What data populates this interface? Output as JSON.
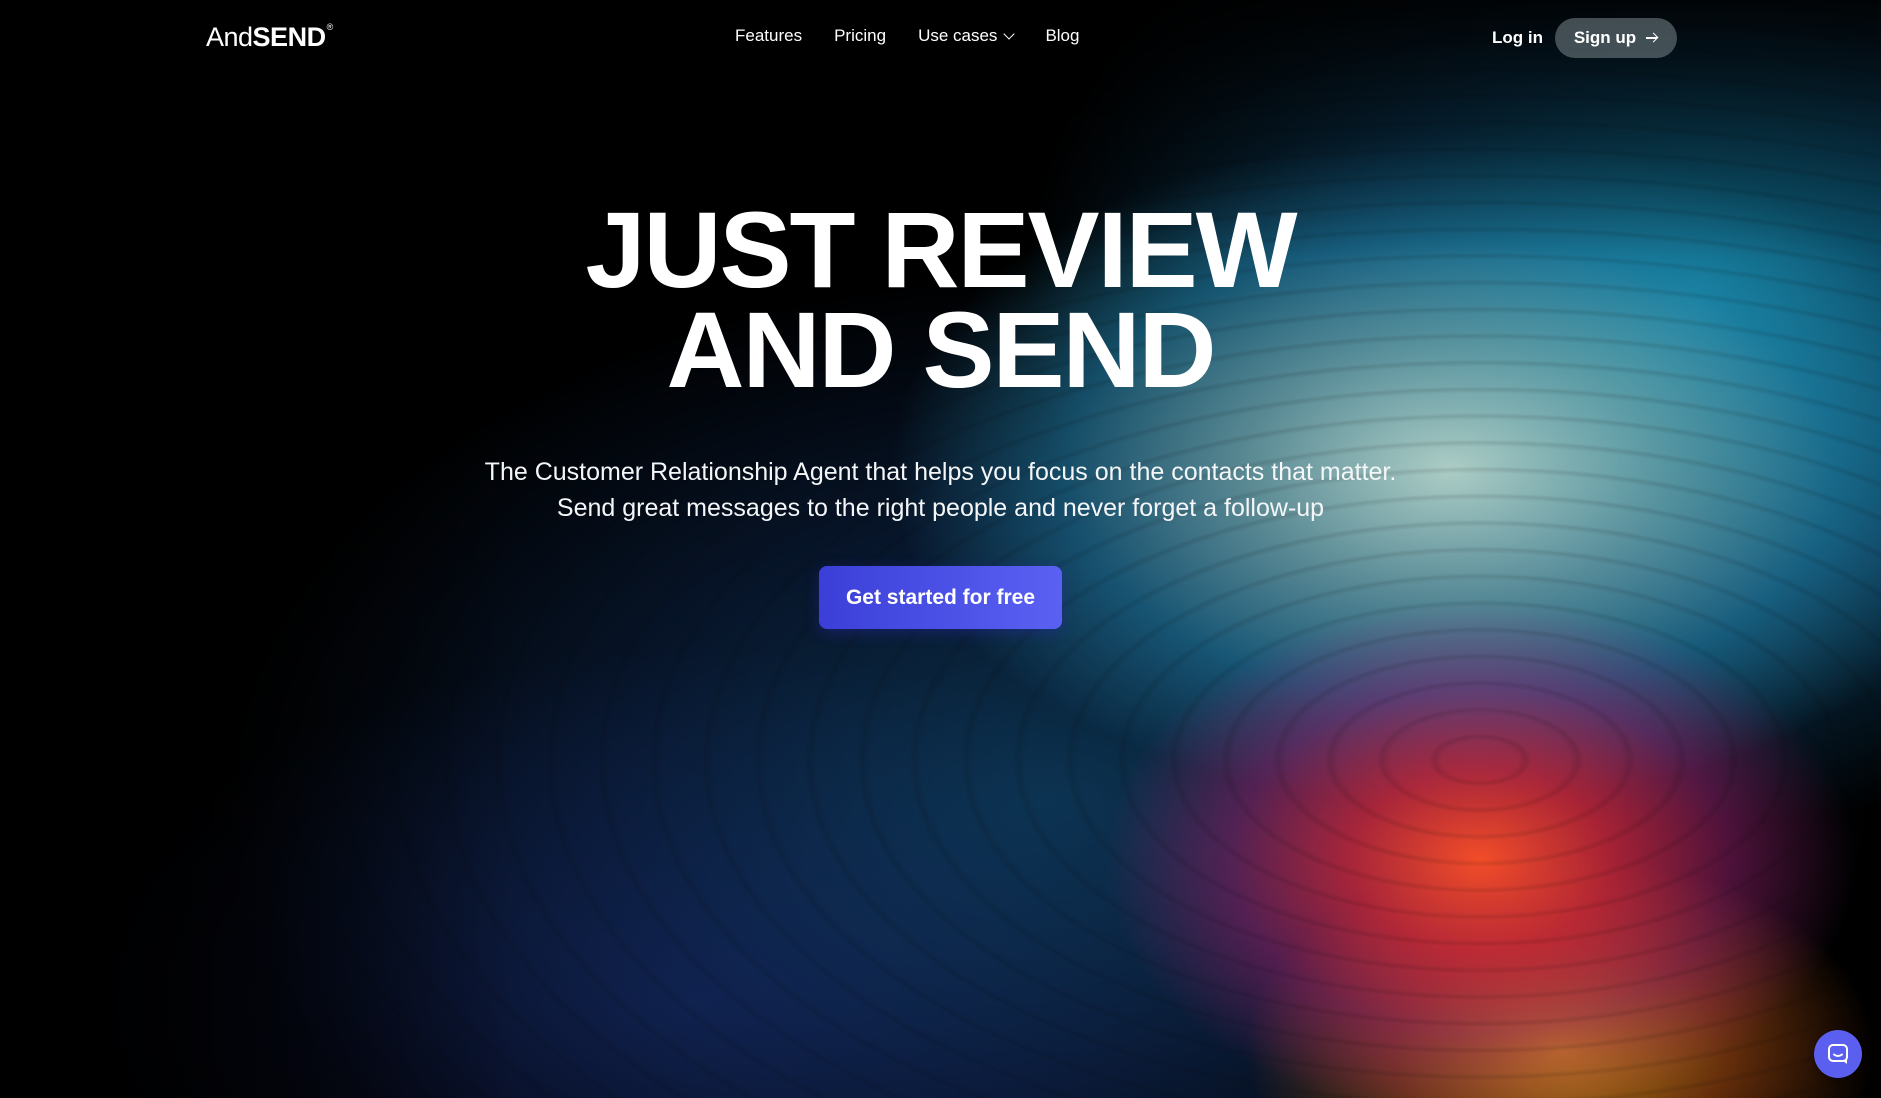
{
  "header": {
    "logo": {
      "and": "And",
      "send": "SEND",
      "tm": "®"
    },
    "nav": [
      {
        "label": "Features"
      },
      {
        "label": "Pricing"
      },
      {
        "label": "Use cases",
        "icon": "chevron-down-icon"
      },
      {
        "label": "Blog"
      }
    ],
    "login_label": "Log in",
    "signup_label": "Sign up",
    "signup_icon": "arrow-right-icon"
  },
  "hero": {
    "title_line1": "JUST REVIEW",
    "title_line2": "AND SEND",
    "subtitle_line1": "The Customer Relationship Agent that helps you focus on the contacts that matter.",
    "subtitle_line2": "Send great messages to the right people and never forget a follow-up",
    "cta_label": "Get started for free"
  },
  "chat_widget": {
    "icon": "chat-bubble-icon"
  },
  "colors": {
    "cta_start": "#3b3fd8",
    "cta_end": "#5a61f2",
    "chat_widget": "#5b5ff0",
    "background": "#000000"
  }
}
